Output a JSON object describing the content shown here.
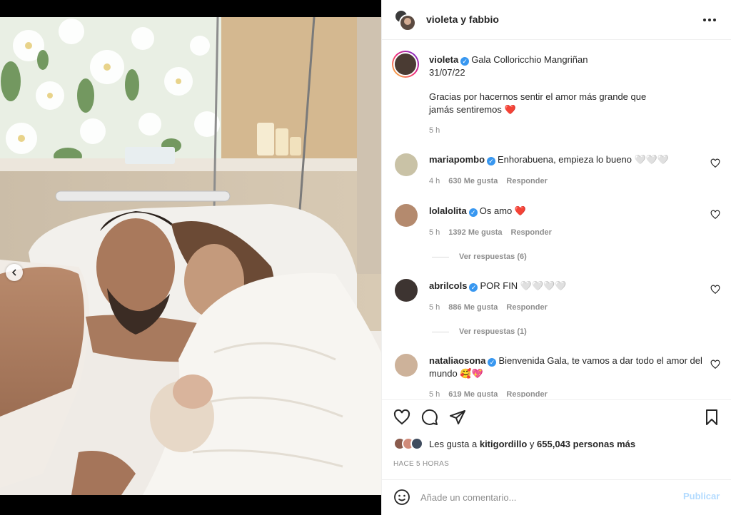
{
  "header": {
    "title": "violeta y fabbio"
  },
  "caption": {
    "username": "violeta",
    "tagged": "Gala Colloricchio Mangriñan",
    "date": "31/07/22",
    "text": "Gracias por hacernos sentir el amor más grande que jamás sentiremos ❤️",
    "time": "5 h"
  },
  "comments": [
    {
      "username": "mariapombo",
      "text": "Enhorabuena, empieza lo bueno 🤍🤍🤍",
      "time": "4 h",
      "likes": "630 Me gusta",
      "reply": "Responder"
    },
    {
      "username": "lolalolita",
      "text": "Os amo ❤️",
      "time": "5 h",
      "likes": "1392 Me gusta",
      "reply": "Responder",
      "view_replies": "Ver respuestas (6)"
    },
    {
      "username": "abrilcols",
      "text": "POR FIN 🤍🤍🤍🤍",
      "time": "5 h",
      "likes": "886 Me gusta",
      "reply": "Responder",
      "view_replies": "Ver respuestas (1)"
    },
    {
      "username": "nataliaosona",
      "text": "Bienvenida Gala, te vamos a dar todo el amor del mundo 🥰💖",
      "time": "5 h",
      "likes": "619 Me gusta",
      "reply": "Responder"
    }
  ],
  "likes": {
    "prefix": "Les gusta a",
    "user": "kitigordillo",
    "connector": "y",
    "count": "655,043 personas más"
  },
  "posted_ago": "HACE 5 HORAS",
  "add_comment": {
    "placeholder": "Añade un comentario...",
    "publish_label": "Publicar"
  },
  "colors": {
    "accent": "#0095f6",
    "publish_disabled": "#b3dbff",
    "verified": "#3897f0",
    "like_red": "#ed4956"
  },
  "carousel": {
    "slides": 10,
    "active_slide": 10
  }
}
